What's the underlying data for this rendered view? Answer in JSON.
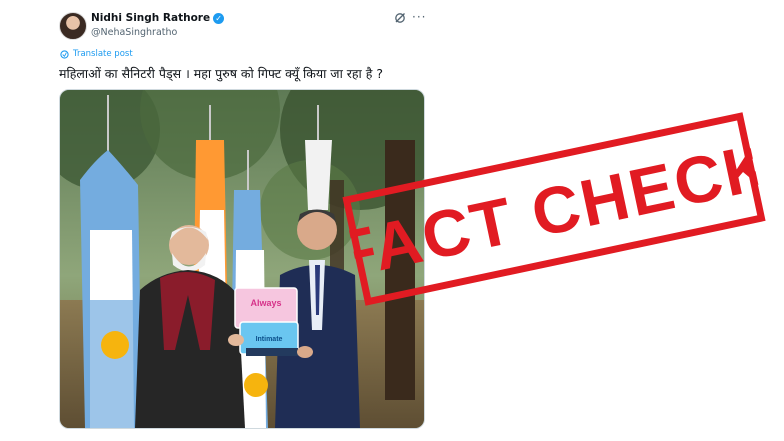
{
  "user": {
    "display_name": "Nidhi Singh Rathore",
    "handle": "@NehaSinghratho",
    "verified": true
  },
  "icons": {
    "avatar": "avatar",
    "verified": "verified-badge-icon",
    "grok": "grok-icon",
    "more": "more-icon",
    "translate": "translate-icon"
  },
  "translate_label": "Translate post",
  "post_text": "महिलाओं का सैनिटरी पैड्स । महा पुरुष को गिफ्ट क्यूँ किया जा रहा है ?",
  "photo": {
    "box_label_top": "Always",
    "box_label_bottom": "Intimate"
  },
  "stamp": {
    "text": "FACT CHECK",
    "color": "#e11b22"
  },
  "colors": {
    "link": "#1d9bf0",
    "text": "#0f1419",
    "muted": "#536471"
  }
}
